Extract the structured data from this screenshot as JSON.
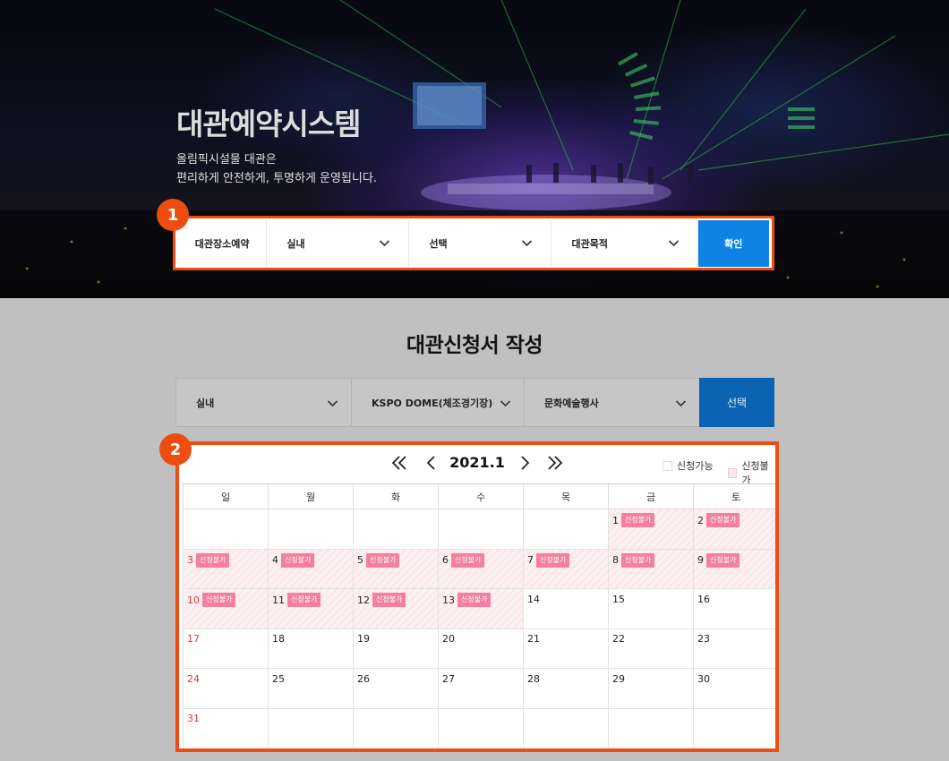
{
  "hero": {
    "title": "대관예약시스템",
    "subtitle_line1": "올림픽시설물 대관은",
    "subtitle_line2": "편리하게 안전하게, 투명하게 운영됩니다."
  },
  "annotations": {
    "badge1": "1",
    "badge2": "2"
  },
  "search": {
    "label": "대관장소예약",
    "select1": "실내",
    "select2": "선택",
    "select3": "대관목적",
    "confirm": "확인"
  },
  "section": {
    "title": "대관신청서 작성"
  },
  "filters": {
    "select1": "실내",
    "select2": "KSPO DOME(체조경기장)",
    "select3": "문화예술행사",
    "button": "선택"
  },
  "calendar": {
    "month": "2021.1",
    "legend_open": "신청가능",
    "legend_closed": "신청불가",
    "weekdays": [
      "일",
      "월",
      "화",
      "수",
      "목",
      "금",
      "토"
    ],
    "unavailable_tag": "신청불가",
    "weeks": [
      [
        null,
        null,
        null,
        null,
        null,
        {
          "d": "1",
          "na": true
        },
        {
          "d": "2",
          "na": true
        }
      ],
      [
        {
          "d": "3",
          "na": true
        },
        {
          "d": "4",
          "na": true
        },
        {
          "d": "5",
          "na": true
        },
        {
          "d": "6",
          "na": true
        },
        {
          "d": "7",
          "na": true
        },
        {
          "d": "8",
          "na": true
        },
        {
          "d": "9",
          "na": true
        }
      ],
      [
        {
          "d": "10",
          "na": true
        },
        {
          "d": "11",
          "na": true
        },
        {
          "d": "12",
          "na": true
        },
        {
          "d": "13",
          "na": true
        },
        {
          "d": "14"
        },
        {
          "d": "15"
        },
        {
          "d": "16"
        }
      ],
      [
        {
          "d": "17"
        },
        {
          "d": "18"
        },
        {
          "d": "19"
        },
        {
          "d": "20"
        },
        {
          "d": "21"
        },
        {
          "d": "22"
        },
        {
          "d": "23"
        }
      ],
      [
        {
          "d": "24"
        },
        {
          "d": "25"
        },
        {
          "d": "26"
        },
        {
          "d": "27"
        },
        {
          "d": "28"
        },
        {
          "d": "29"
        },
        {
          "d": "30"
        }
      ],
      [
        {
          "d": "31"
        },
        null,
        null,
        null,
        null,
        null,
        null
      ]
    ]
  },
  "colors": {
    "accent_orange": "#ee4d12",
    "confirm_blue": "#0f83e5",
    "select_blue": "#0b63b3",
    "tag_pink": "#f47fa0",
    "sunday_red": "#d23b3b"
  }
}
